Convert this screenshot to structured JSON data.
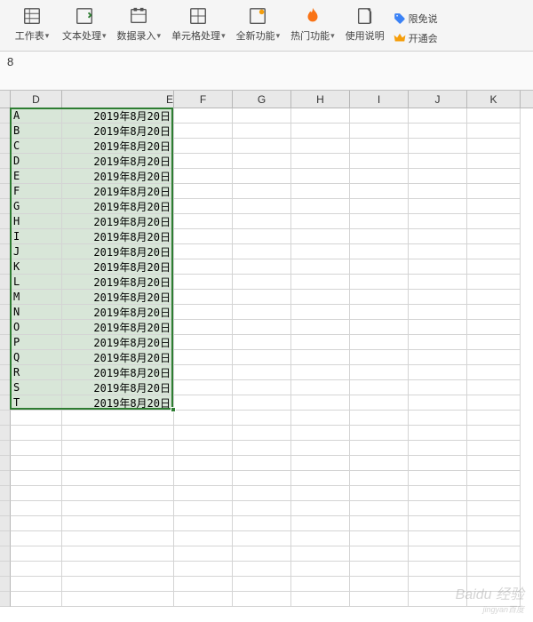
{
  "toolbar": {
    "items": [
      {
        "label": "工作表",
        "icon": "sheet-icon"
      },
      {
        "label": "文本处理",
        "icon": "text-icon"
      },
      {
        "label": "数据录入",
        "icon": "data-entry-icon"
      },
      {
        "label": "单元格处理",
        "icon": "cell-icon"
      },
      {
        "label": "全新功能",
        "icon": "new-icon"
      },
      {
        "label": "热门功能",
        "icon": "hot-icon"
      },
      {
        "label": "使用说明",
        "icon": "help-icon"
      }
    ],
    "side": [
      {
        "label": "限免说",
        "icon": "tag-icon",
        "color": "#3b82f6"
      },
      {
        "label": "开通会",
        "icon": "crown-icon",
        "color": "#f59e0b"
      }
    ]
  },
  "formula_bar": {
    "value": "8"
  },
  "columns": [
    "D",
    "E",
    "F",
    "G",
    "H",
    "I",
    "J",
    "K"
  ],
  "chart_data": {
    "type": "table",
    "columns": [
      "D",
      "E"
    ],
    "rows": [
      {
        "D": "A",
        "E": "2019年8月20日"
      },
      {
        "D": "B",
        "E": "2019年8月20日"
      },
      {
        "D": "C",
        "E": "2019年8月20日"
      },
      {
        "D": "D",
        "E": "2019年8月20日"
      },
      {
        "D": "E",
        "E": "2019年8月20日"
      },
      {
        "D": "F",
        "E": "2019年8月20日"
      },
      {
        "D": "G",
        "E": "2019年8月20日"
      },
      {
        "D": "H",
        "E": "2019年8月20日"
      },
      {
        "D": "I",
        "E": "2019年8月20日"
      },
      {
        "D": "J",
        "E": "2019年8月20日"
      },
      {
        "D": "K",
        "E": "2019年8月20日"
      },
      {
        "D": "L",
        "E": "2019年8月20日"
      },
      {
        "D": "M",
        "E": "2019年8月20日"
      },
      {
        "D": "N",
        "E": "2019年8月20日"
      },
      {
        "D": "O",
        "E": "2019年8月20日"
      },
      {
        "D": "P",
        "E": "2019年8月20日"
      },
      {
        "D": "Q",
        "E": "2019年8月20日"
      },
      {
        "D": "R",
        "E": "2019年8月20日"
      },
      {
        "D": "S",
        "E": "2019年8月20日"
      },
      {
        "D": "T",
        "E": "2019年8月20日"
      }
    ]
  },
  "empty_rows_after": 13,
  "watermark": {
    "main": "Baidu 经验",
    "sub": "jingyan百度"
  }
}
